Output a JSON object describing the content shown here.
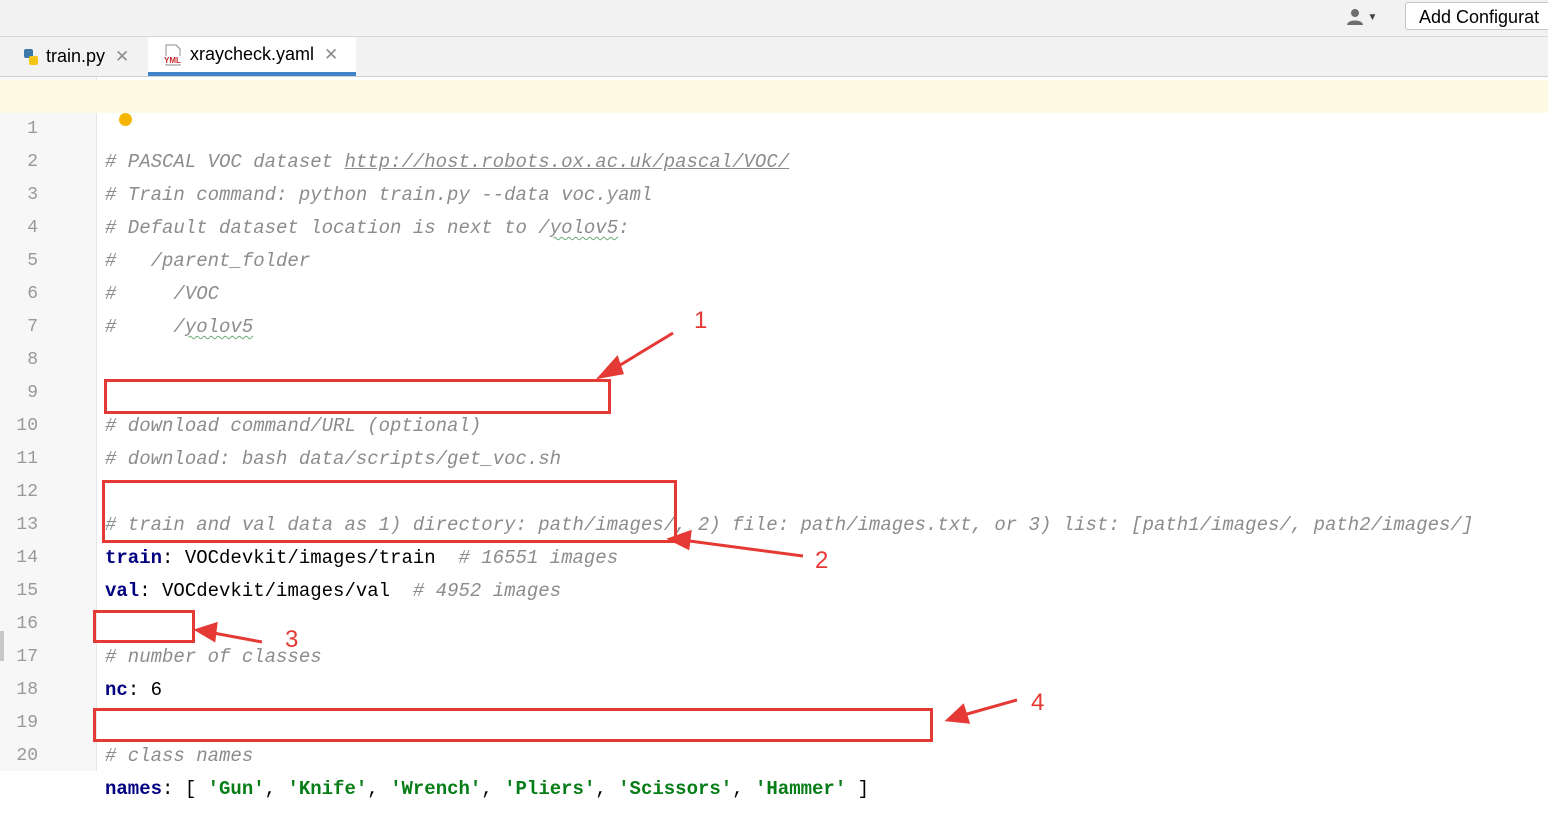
{
  "toolbar": {
    "user_icon": "user-icon",
    "add_configuration_label": "Add Configurat"
  },
  "tabs": [
    {
      "label": "train.py",
      "icon": "python-file-icon",
      "active": false
    },
    {
      "label": "xraycheck.yaml",
      "icon": "yaml-file-icon",
      "active": true
    }
  ],
  "editor": {
    "gutter_mark": "3",
    "lines": [
      {
        "n": "1"
      },
      {
        "n": "2"
      },
      {
        "n": "3"
      },
      {
        "n": "4"
      },
      {
        "n": "5"
      },
      {
        "n": "6"
      },
      {
        "n": "7"
      },
      {
        "n": "8"
      },
      {
        "n": "9"
      },
      {
        "n": "10"
      },
      {
        "n": "11"
      },
      {
        "n": "12"
      },
      {
        "n": "13"
      },
      {
        "n": "14"
      },
      {
        "n": "15"
      },
      {
        "n": "16"
      },
      {
        "n": "17"
      },
      {
        "n": "18"
      },
      {
        "n": "19"
      },
      {
        "n": "20"
      }
    ],
    "l1_prefix": "# PASCAL VOC dataset ",
    "l1_url": "http://host.robots.ox.ac.uk/pascal/VOC/",
    "l2": "# Train command: python train.py --data voc.yaml",
    "l3_prefix": "# Default dataset location is next to /",
    "l3_word": "yolov5",
    "l3_suffix": ":",
    "l4": "#   /parent_folder",
    "l5": "#     /VOC",
    "l6_prefix": "#     /",
    "l6_word": "yolov5",
    "l9": "# download command/URL (optional)",
    "l10": "# download: bash data/scripts/get_voc.sh",
    "l12": "# train and val data as 1) directory: path/images/, 2) file: path/images.txt, or 3) list: [path1/images/, path2/images/]",
    "l13_key": "train",
    "l13_value": ": VOCdevkit/images/train  ",
    "l13_comment": "# 16551 images",
    "l14_key": "val",
    "l14_value": ": VOCdevkit/images/val  ",
    "l14_comment": "# 4952 images",
    "l16": "# number of classes",
    "l17_key": "nc",
    "l17_value": ": 6",
    "l19": "# class names",
    "l20_key": "names",
    "l20_open": ": [ ",
    "l20_items": [
      "'Gun'",
      "'Knife'",
      "'Wrench'",
      "'Pliers'",
      "'Scissors'",
      "'Hammer'"
    ],
    "l20_sep": ", ",
    "l20_close": " ]"
  },
  "annotations": {
    "color": "#e53935",
    "labels": [
      "1",
      "2",
      "3",
      "4"
    ]
  },
  "colors": {
    "comment": "#8c8c8c",
    "key": "#000080",
    "string": "#067d17",
    "annotation": "#e53935",
    "current_line": "#fdfbe2"
  }
}
